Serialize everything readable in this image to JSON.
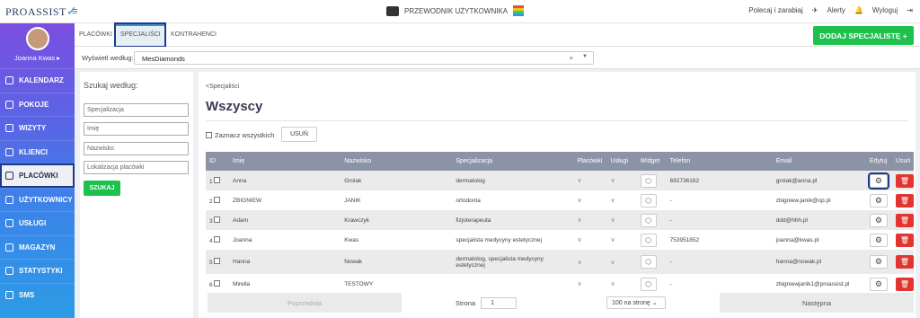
{
  "topbar": {
    "logo": "PROASSIST",
    "guide_label": "PRZEWODNIK UŻYTKOWNIKA",
    "recommend_label": "Polecaj i zarabiaj",
    "alerts_label": "Alerty",
    "logout_label": "Wyloguj"
  },
  "sidebar": {
    "user_name": "Joanna Kwas ▸",
    "items": [
      {
        "label": "KALENDARZ"
      },
      {
        "label": "POKOJE"
      },
      {
        "label": "WIZYTY"
      },
      {
        "label": "KLIENCI"
      },
      {
        "label": "PLACÓWKI"
      },
      {
        "label": "UŻYTKOWNICY"
      },
      {
        "label": "USŁUGI"
      },
      {
        "label": "MAGAZYN"
      },
      {
        "label": "STATYSTYKI"
      },
      {
        "label": "SMS"
      }
    ]
  },
  "tabs": {
    "t1": "PLACÓWKI",
    "t2": "SPECJALIŚCI",
    "t3": "KONTRAHENCI",
    "add_button": "DODAJ SPECJALISTĘ +"
  },
  "filter": {
    "label": "Wyświetl według:",
    "value": "MesDiamonds"
  },
  "search": {
    "title": "Szukaj według:",
    "p1": "Specjalizacja",
    "p2": "Imię",
    "p3": "Nazwisko",
    "p4": "Lokalizacja placówki",
    "button": "SZUKAJ"
  },
  "main": {
    "breadcrumb": "<Specjaliści",
    "title": "Wszyscy",
    "select_all": "Zaznacz wszystkich",
    "delete_button": "USUŃ"
  },
  "table": {
    "headers": {
      "id": "ID",
      "first": "Imię",
      "last": "Nazwisko",
      "spec": "Specjalizacja",
      "plac": "Placówki",
      "uslugi": "Usługi",
      "widget": "Widget",
      "tel": "Telefon",
      "email": "Email",
      "edit": "Edytuj",
      "del": "Usuń"
    },
    "rows": [
      {
        "id": "1",
        "first": "Anna",
        "last": "Grolak",
        "spec": "dermatolog",
        "tel": "692736162",
        "email": "grolak@anna.pl"
      },
      {
        "id": "2",
        "first": "ZBIGNIEW",
        "last": "JANIK",
        "spec": "ortodonta",
        "tel": "-",
        "email": "zbigniew.janik@op.pl"
      },
      {
        "id": "3",
        "first": "Adam",
        "last": "Krawczyk",
        "spec": "fizjoterapeuta",
        "tel": "-",
        "email": "ddd@hhh.pl"
      },
      {
        "id": "4",
        "first": "Joanna",
        "last": "Kwas",
        "spec": "specjalista medycyny estetycznej",
        "tel": "753951852",
        "email": "joanna@kwas.pl"
      },
      {
        "id": "5",
        "first": "Hanna",
        "last": "Nowak",
        "spec": "dermatolog, specjalista medycyny estetycznej",
        "tel": "-",
        "email": "hanna@nowak.pl"
      },
      {
        "id": "6",
        "first": "Mirella",
        "last": "TESTOWY",
        "spec": "",
        "tel": "-",
        "email": "zbigniewjanik1@proassist.pl"
      }
    ]
  },
  "pager": {
    "prev": "Poprzednia",
    "page_label": "Strona",
    "page_value": "1",
    "per_page": "100 na stronę",
    "next": "Następna"
  },
  "colors": {
    "accent_green": "#1ec14e",
    "delete_red": "#e3342f",
    "table_header": "#8d93a6",
    "highlight_outline": "#1d3a8a"
  }
}
